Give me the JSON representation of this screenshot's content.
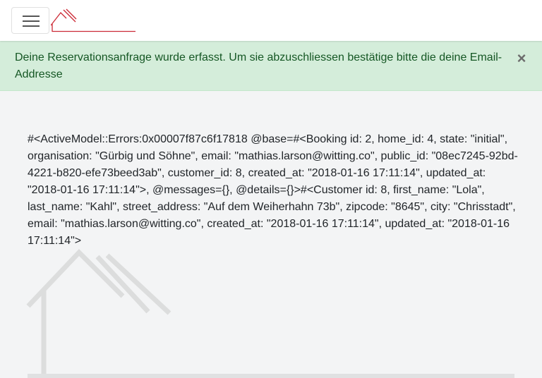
{
  "navbar": {
    "toggler_icon": "hamburger-icon",
    "brand_icon": "house-logo",
    "brand_color": "#cc2a36"
  },
  "alert": {
    "message": "Deine Reservationsanfrage wurde erfasst. Um sie abzuschliessen bestätige bitte die deine Email-Addresse",
    "close_label": "×",
    "background": "#d4edda",
    "text_color": "#155724"
  },
  "main": {
    "error_output": "#<ActiveModel::Errors:0x00007f87c6f17818 @base=#<Booking id: 2, home_id: 4, state: \"initial\", organisation: \"Gürbig und Söhne\", email: \"mathias.larson@witting.co\", public_id: \"08ec7245-92bd-4221-b820-efe73beed3ab\", customer_id: 8, created_at: \"2018-01-16 17:11:14\", updated_at: \"2018-01-16 17:11:14\">, @messages={}, @details={}>#<Customer id: 8, first_name: \"Lola\", last_name: \"Kahl\", street_address: \"Auf dem Weiherhahn 73b\", zipcode: \"8645\", city: \"Chrisstadt\", email: \"mathias.larson@witting.co\", created_at: \"2018-01-16 17:11:14\", updated_at: \"2018-01-16 17:11:14\">",
    "watermark_icon": "house-watermark"
  }
}
